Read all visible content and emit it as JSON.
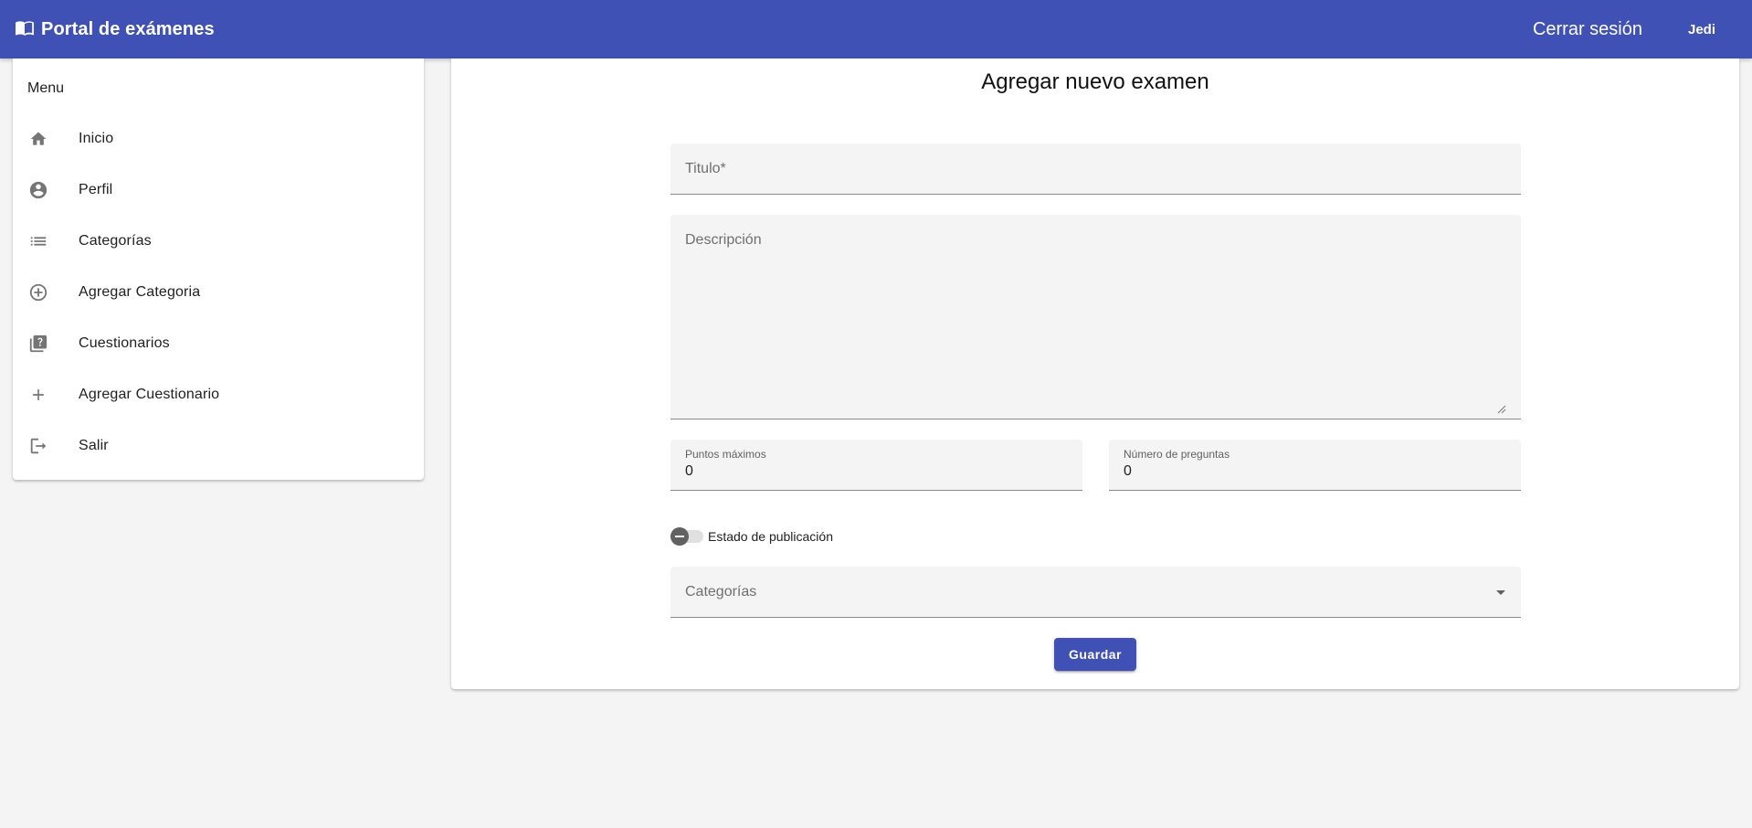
{
  "header": {
    "title": "Portal de exámenes",
    "logout_label": "Cerrar sesión",
    "user_label": "Jedi",
    "brand_color": "#3f51b5",
    "brand_icon": "menu-book-icon"
  },
  "sidebar": {
    "title": "Menu",
    "items": [
      {
        "label": "Inicio",
        "icon": "home-icon"
      },
      {
        "label": "Perfil",
        "icon": "account-circle-icon"
      },
      {
        "label": "Categorías",
        "icon": "list-icon"
      },
      {
        "label": "Agregar Categoria",
        "icon": "add-circle-outline-icon"
      },
      {
        "label": "Cuestionarios",
        "icon": "quiz-icon"
      },
      {
        "label": "Agregar Cuestionario",
        "icon": "plus-icon"
      },
      {
        "label": "Salir",
        "icon": "logout-icon"
      }
    ]
  },
  "form": {
    "heading": "Agregar nuevo examen",
    "title_placeholder": "Titulo*",
    "description_placeholder": "Descripción",
    "max_points_label": "Puntos máximos",
    "max_points_value": "0",
    "num_questions_label": "Número de preguntas",
    "num_questions_value": "0",
    "publish_toggle_label": "Estado de publicación",
    "publish_toggle_checked": false,
    "categories_placeholder": "Categorías",
    "save_label": "Guardar"
  }
}
